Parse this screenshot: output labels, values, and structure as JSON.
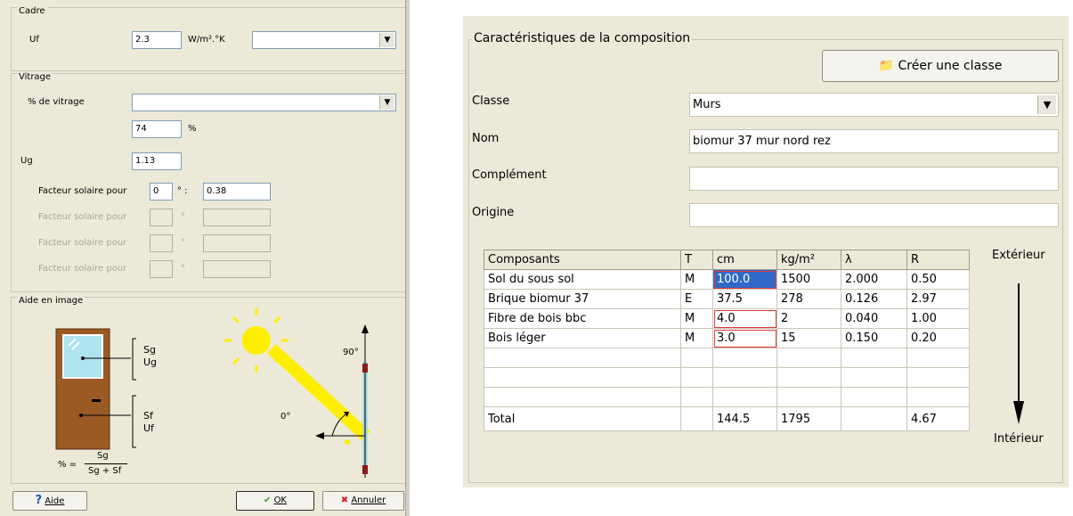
{
  "left_dialog": {
    "cadre": {
      "legend": "Cadre",
      "uf_label": "Uf",
      "uf_value": "2.3",
      "uf_unit": "W/m².°K",
      "uf_select_value": ""
    },
    "vitrage": {
      "legend": "Vitrage",
      "pct_label": "% de vitrage",
      "pct_select_value": "",
      "pct_value": "74",
      "pct_unit": "%",
      "ug_label": "Ug",
      "ug_value": "1.13",
      "solar_rows": [
        {
          "label": "Facteur solaire pour",
          "angle": "0",
          "value": "0.38",
          "enabled": true
        },
        {
          "label": "Facteur solaire pour",
          "angle": "",
          "value": "",
          "enabled": false
        },
        {
          "label": "Facteur solaire pour",
          "angle": "",
          "value": "",
          "enabled": false
        },
        {
          "label": "Facteur solaire pour",
          "angle": "",
          "value": "",
          "enabled": false
        }
      ],
      "degree_sep": "° :"
    },
    "aide": {
      "legend": "Aide en image",
      "sg": "Sg",
      "ug": "Ug",
      "sf": "Sf",
      "uf": "Uf",
      "formula_lhs": "% =",
      "formula_num": "Sg",
      "formula_den": "Sg + Sf",
      "angle_90": "90°",
      "angle_0": "0°"
    },
    "buttons": {
      "help": "Aide",
      "ok": "OK",
      "cancel": "Annuler"
    }
  },
  "composition": {
    "legend": "Caractéristiques de la composition",
    "create_class_button": "Créer une classe",
    "classe_label": "Classe",
    "classe_value": "Murs",
    "nom_label": "Nom",
    "nom_value": "biomur 37 mur nord rez",
    "complement_label": "Complément",
    "complement_value": "",
    "origine_label": "Origine",
    "origine_value": "",
    "exterior_label": "Extérieur",
    "interior_label": "Intérieur",
    "table": {
      "headers": [
        "Composants",
        "T",
        "cm",
        "kg/m²",
        "λ",
        "R"
      ],
      "rows": [
        [
          "Sol du sous sol",
          "M",
          "100.0",
          "1500",
          "2.000",
          "0.50"
        ],
        [
          "Brique biomur 37",
          "E",
          "37.5",
          "278",
          "0.126",
          "2.97"
        ],
        [
          "Fibre de bois bbc",
          "M",
          "4.0",
          "2",
          "0.040",
          "1.00"
        ],
        [
          "Bois léger",
          "M",
          "3.0",
          "15",
          "0.150",
          "0.20"
        ],
        [
          "",
          "",
          "",
          "",
          "",
          ""
        ],
        [
          "",
          "",
          "",
          "",
          "",
          ""
        ],
        [
          "",
          "",
          "",
          "",
          "",
          ""
        ]
      ],
      "total": [
        "Total",
        "",
        "144.5",
        "1795",
        "",
        "4.67"
      ]
    }
  },
  "colors": {
    "dialog_bg": "#ece9d8",
    "selection": "#3169c6",
    "highlight_border": "#e03b3b",
    "sun": "#ffee00",
    "door": "#9b5a24"
  }
}
